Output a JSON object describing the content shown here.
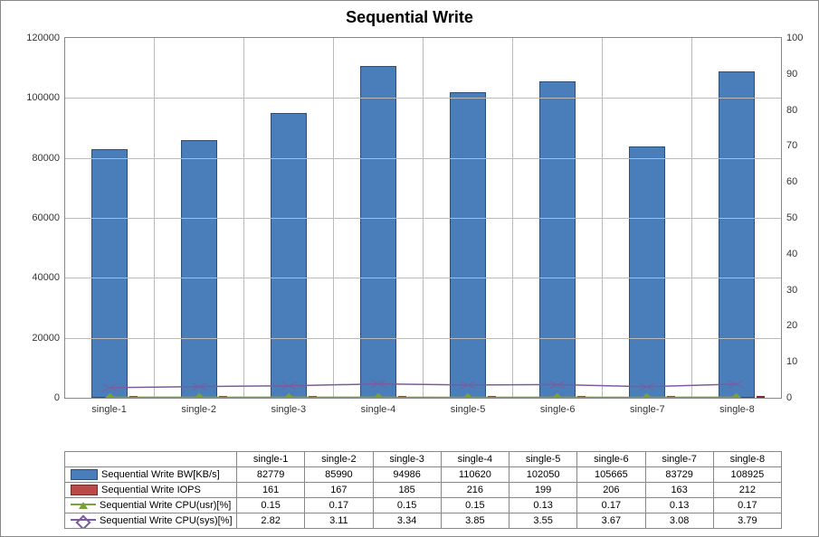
{
  "chart_data": {
    "type": "bar",
    "title": "Sequential Write",
    "categories": [
      "single-1",
      "single-2",
      "single-3",
      "single-4",
      "single-5",
      "single-6",
      "single-7",
      "single-8"
    ],
    "y_left": {
      "min": 0,
      "max": 120000,
      "step": 20000,
      "label": ""
    },
    "y_right": {
      "min": 0,
      "max": 100,
      "step": 10,
      "label": ""
    },
    "series": [
      {
        "name": "Sequential Write BW[KB/s]",
        "axis": "left",
        "kind": "bar",
        "color": "#4a7ebb",
        "values": [
          82779,
          85990,
          94986,
          110620,
          102050,
          105665,
          83729,
          108925
        ]
      },
      {
        "name": "Sequential Write IOPS",
        "axis": "left",
        "kind": "bar",
        "color": "#b94a48",
        "values": [
          161,
          167,
          185,
          216,
          199,
          206,
          163,
          212
        ]
      },
      {
        "name": "Sequential Write CPU(usr)[%]",
        "axis": "right",
        "kind": "line",
        "color": "#7aa23a",
        "marker": "triangle",
        "values": [
          0.15,
          0.17,
          0.15,
          0.15,
          0.13,
          0.17,
          0.13,
          0.17
        ]
      },
      {
        "name": "Sequential Write CPU(sys)[%]",
        "axis": "right",
        "kind": "line",
        "color": "#7a5c9e",
        "marker": "x",
        "values": [
          2.82,
          3.11,
          3.34,
          3.85,
          3.55,
          3.67,
          3.08,
          3.79
        ]
      }
    ]
  },
  "table": {
    "rows": [
      {
        "swatch": "sw-bar-blue",
        "label": "Sequential Write BW[KB/s]",
        "cells": [
          "82779",
          "85990",
          "94986",
          "110620",
          "102050",
          "105665",
          "83729",
          "108925"
        ]
      },
      {
        "swatch": "sw-bar-red",
        "label": "Sequential Write IOPS",
        "cells": [
          "161",
          "167",
          "185",
          "216",
          "199",
          "206",
          "163",
          "212"
        ]
      },
      {
        "swatch": "sw-line-green",
        "label": "Sequential Write CPU(usr)[%]",
        "cells": [
          "0.15",
          "0.17",
          "0.15",
          "0.15",
          "0.13",
          "0.17",
          "0.13",
          "0.17"
        ]
      },
      {
        "swatch": "sw-line-purple",
        "label": "Sequential Write CPU(sys)[%]",
        "cells": [
          "2.82",
          "3.11",
          "3.34",
          "3.85",
          "3.55",
          "3.67",
          "3.08",
          "3.79"
        ]
      }
    ]
  }
}
